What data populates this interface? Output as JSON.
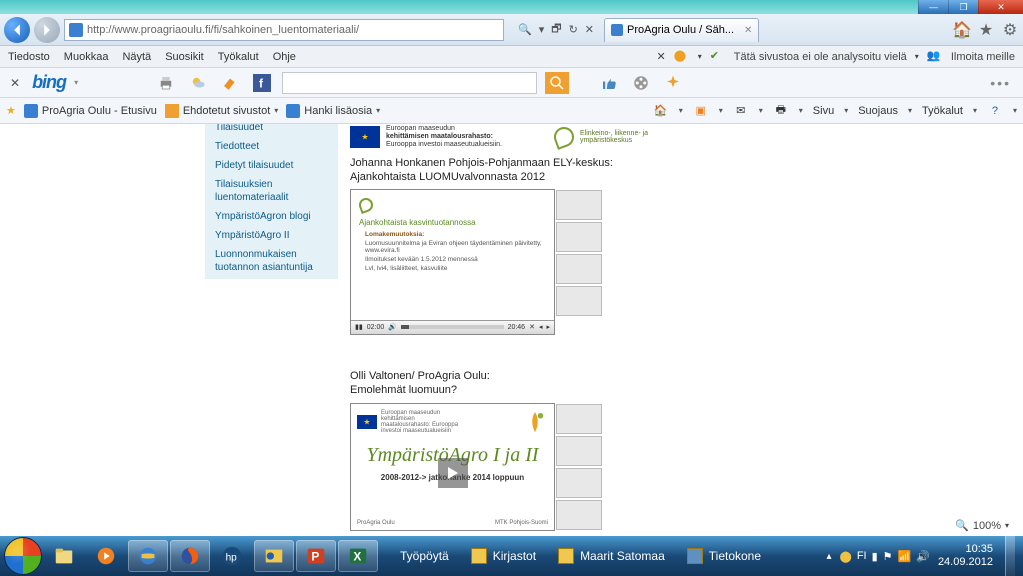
{
  "window": {
    "url": "http://www.proagriaoulu.fi/fi/sahkoinen_luentomateriaali/",
    "search_hint": "🔍",
    "tab_title": "ProAgria Oulu / Säh...",
    "zoom": "100%"
  },
  "menu": {
    "items": [
      "Tiedosto",
      "Muokkaa",
      "Näytä",
      "Suosikit",
      "Työkalut",
      "Ohje"
    ],
    "safety_msg": "Tätä sivustoa ei ole analysoitu vielä",
    "report": "Ilmoita meille"
  },
  "bing": {
    "brand": "bing"
  },
  "fav": {
    "item1": "ProAgria Oulu - Etusivu",
    "item2": "Ehdotetut sivustot",
    "item3": "Hanki lisäosia",
    "right": [
      "Sivu",
      "Suojaus",
      "Työkalut"
    ]
  },
  "sidebar": {
    "items": [
      "Tilaisuudet",
      "Tiedotteet",
      "Pidetyt tilaisuudet",
      "Tilaisuuksien luentomateriaalit",
      "YmpäristöAgron blogi",
      "YmpäristöAgro II",
      "Luonnonmukaisen tuotannon asiantuntija"
    ]
  },
  "banner": {
    "line1": "Euroopan maaseudun",
    "line2": "kehittämisen maatalousrahasto:",
    "line3": "Eurooppa investoi maaseutualueisiin.",
    "logo2a": "Elinkeino-, liikenne- ja",
    "logo2b": "ympäristökeskus"
  },
  "video1": {
    "author": "Johanna Honkanen Pohjois-Pohjanmaan ELY-keskus:",
    "title": "Ajankohtaista LUOMUvalvonnasta 2012",
    "slide_h": "Ajankohtaista kasvintuotannossa",
    "slide_sub": "Lomakemuutoksia:",
    "b1": "Luomusuunnitelma ja Eviran ohjeen täydentäminen päivitetty, www.evira.fi",
    "b2": "Ilmoitukset kevään 1.5.2012 mennessä",
    "b3": "Lvl, lvi4, lisäliitteet, kasvuliite",
    "time_cur": "02:00",
    "time_tot": "20:46"
  },
  "video2": {
    "author": "Olli Valtonen/ ProAgria Oulu:",
    "title": "Emolehmät luomuun?",
    "ya_title": "YmpäristöAgro I ja II",
    "ya_sub": "2008-2012-> jatkohanke 2014 loppuun",
    "eu_txt": "Euroopan maaseudun kehittämisen maatalousrahasto: Eurooppa investoi maaseutualueisiin"
  },
  "taskbar": {
    "labels": [
      "Työpöytä",
      "Kirjastot",
      "Maarit Satomaa",
      "Tietokone"
    ],
    "lang": "FI",
    "time": "10:35",
    "date": "24.09.2012"
  }
}
